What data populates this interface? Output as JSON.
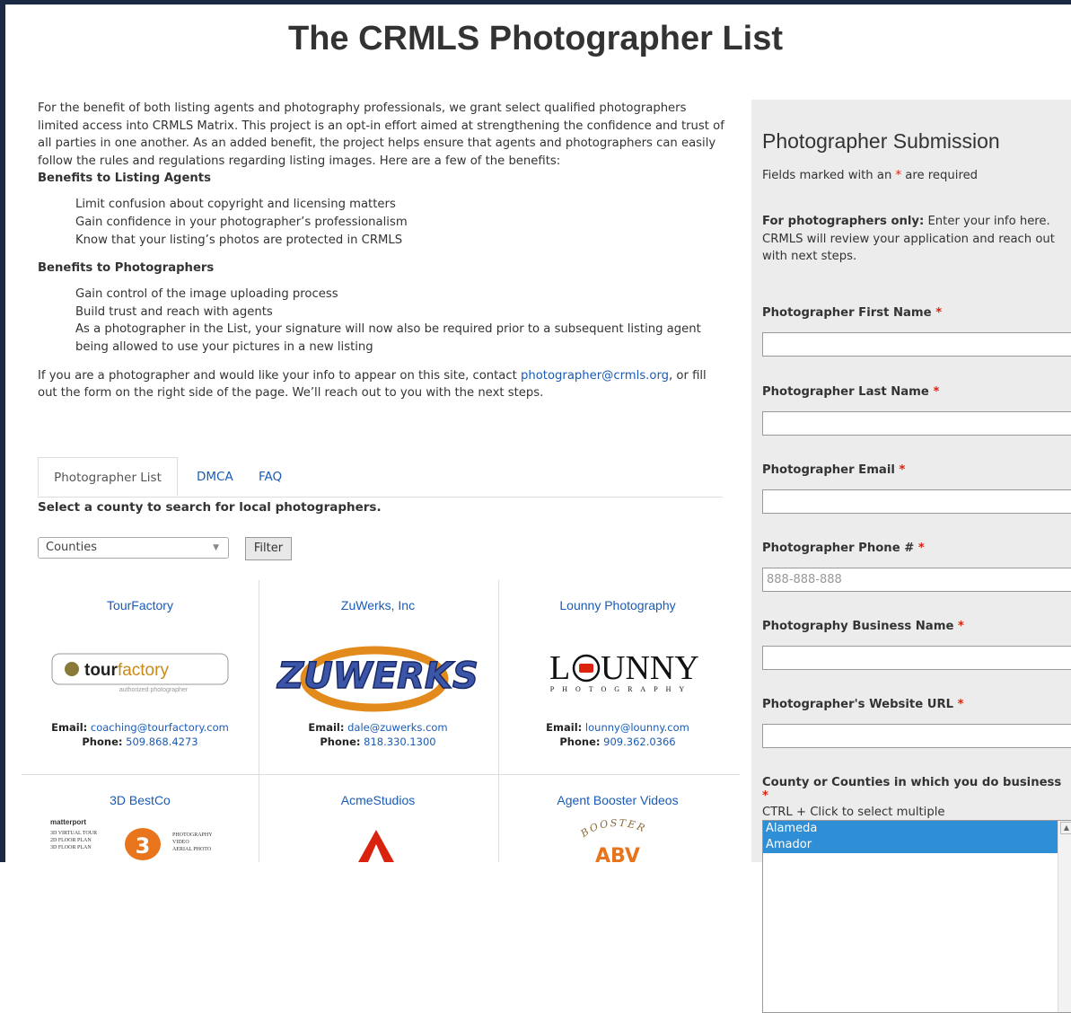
{
  "page": {
    "title": "The CRMLS Photographer List"
  },
  "intro": {
    "paragraph": "For the benefit of both listing agents and photography professionals, we grant select qualified photographers limited access into CRMLS Matrix. This project is an opt-in effort aimed at strengthening the confidence and trust of all parties in one another. As an added benefit, the project helps ensure that agents and photographers can easily follow the rules and regulations regarding listing images. Here are a few of the benefits:",
    "agents_heading": "Benefits to Listing Agents",
    "agents_items": [
      "Limit confusion about copyright and licensing matters",
      "Gain confidence in your photographer’s professionalism",
      "Know that your listing’s photos are protected in CRMLS"
    ],
    "photographers_heading": "Benefits to Photographers",
    "photographers_items": [
      "Gain control of the image uploading process",
      "Build trust and reach with agents",
      "As a photographer in the List, your signature will now also be required prior to a subsequent listing agent being allowed to use your pictures in a new listing"
    ],
    "contact_before": "If you are a photographer and would like your info to appear on this site, contact ",
    "contact_email": "photographer@crmls.org",
    "contact_after": ", or fill out the form on the right side of the page. We’ll reach out to you with the next steps."
  },
  "tabs": [
    "Photographer List",
    "DMCA",
    "FAQ"
  ],
  "search": {
    "heading": "Select a county to search for local photographers.",
    "select_value": "Counties",
    "filter_label": "Filter"
  },
  "labels": {
    "email": "Email:",
    "phone": "Phone:"
  },
  "photographers": [
    {
      "name": "TourFactory",
      "email": "coaching@tourfactory.com",
      "phone": "509.868.4273",
      "logo": "tourfactory-logo"
    },
    {
      "name": "ZuWerks, Inc",
      "email": "dale@zuwerks.com",
      "phone": "818.330.1300",
      "logo": "zuwerks-logo"
    },
    {
      "name": "Lounny Photography",
      "email": "lounny@lounny.com",
      "phone": "909.362.0366",
      "logo": "lounny-logo"
    },
    {
      "name": "3D BestCo",
      "logo": "3d-bestco-logo"
    },
    {
      "name": "AcmeStudios",
      "logo": "acmestudios-logo"
    },
    {
      "name": "Agent Booster Videos",
      "logo": "agent-booster-logo"
    }
  ],
  "logos": {
    "tourfactory_word1": "tour",
    "tourfactory_word2": "factory",
    "tourfactory_sub": "authorized photographer",
    "zuwerks": "ZUWERKS",
    "lounny_main1": "L",
    "lounny_main2": "UNNY",
    "lounny_sub": "PHOTOGRAPHY",
    "matterport": "matterport",
    "bestco_lines": [
      "3D VIRTUAL TOUR",
      "2D FLOOR PLAN",
      "3D FLOOR PLAN"
    ],
    "bestco_right": [
      "PHOTOGRAPHY",
      "VIDEO",
      "AERIAL PHOTO"
    ],
    "booster_arc": "BOOSTER",
    "booster_abv": "ABV"
  },
  "form": {
    "title": "Photographer Submission",
    "required_note_before": "Fields marked with an ",
    "required_note_after": " are required",
    "intro_bold": "For photographers only:",
    "intro_text": " Enter your info here. CRMLS will review your application and reach out with next steps.",
    "required_mark": "*",
    "fields": [
      {
        "label": "Photographer First Name",
        "value": ""
      },
      {
        "label": "Photographer Last Name",
        "value": ""
      },
      {
        "label": "Photographer Email",
        "value": ""
      },
      {
        "label": "Photographer Phone #",
        "placeholder": "888-888-888"
      },
      {
        "label": "Photography Business Name",
        "value": ""
      },
      {
        "label": "Photographer's Website URL",
        "value": ""
      }
    ],
    "county_label": "County or Counties in which you do business",
    "county_hint": "CTRL + Click to select multiple",
    "county_options": [
      "Alameda",
      "Amador"
    ]
  },
  "colors": {
    "link": "#1a5bb6",
    "required": "#d9230f",
    "selected": "#2e8ed6",
    "sidebar_bg": "#ececec"
  }
}
